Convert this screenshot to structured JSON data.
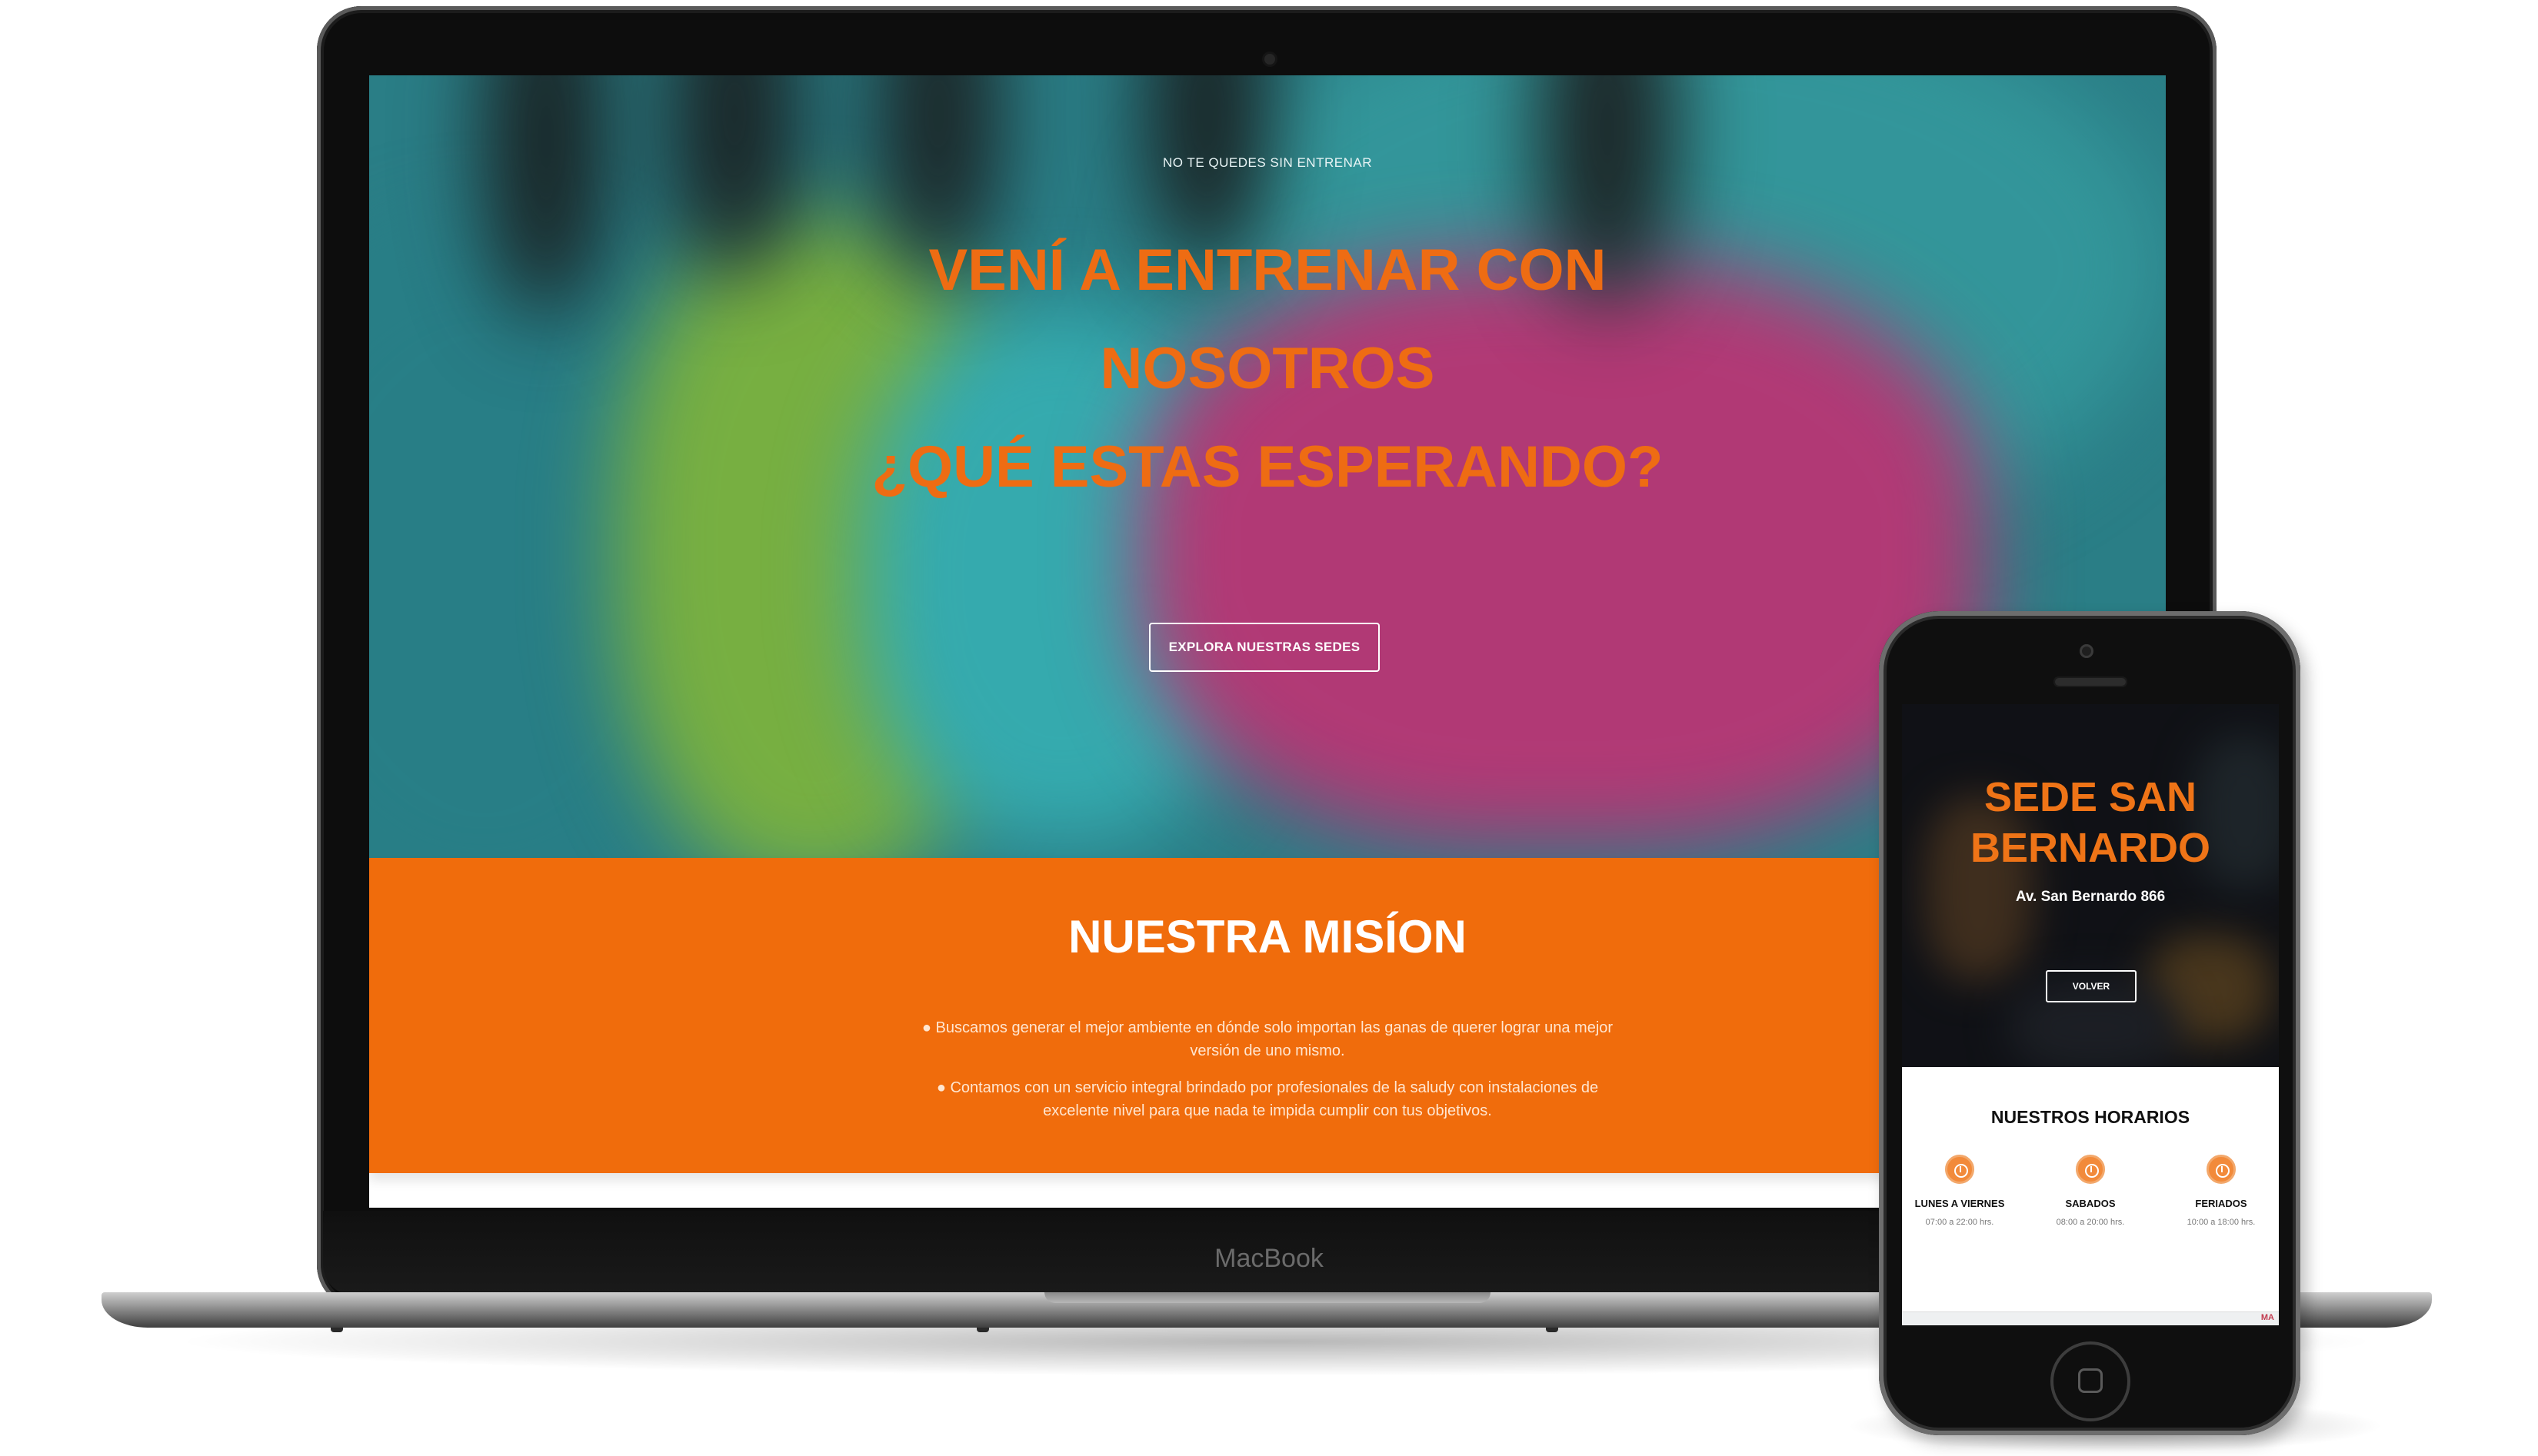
{
  "laptop": {
    "brand": "MacBook",
    "hero": {
      "kicker": "NO TE QUEDES SIN ENTRENAR",
      "title_lines": [
        "VENÍ A ENTRENAR CON",
        "NOSOTROS",
        "¿QUÉ ESTAS ESPERANDO?"
      ],
      "button_label": "EXPLORA NUESTRAS SEDES"
    },
    "mission": {
      "title": "NUESTRA MISÍON",
      "paragraphs": [
        "● Buscamos generar el mejor ambiente en dónde solo importan las ganas de querer lograr una mejor versión de uno mismo.",
        "● Contamos con un servicio integral brindado por profesionales de la saludy con instalaciones de excelente nivel para que nada te impida cumplir con tus objetivos."
      ]
    }
  },
  "phone": {
    "sede_title": "SEDE SAN BERNARDO",
    "address": "Av. San Bernardo 866",
    "button_label": "VOLVER",
    "horarios": {
      "title": "NUESTROS HORARIOS",
      "columns": [
        {
          "day": "LUNES A VIERNES",
          "hours": "07:00 a 22:00 hrs."
        },
        {
          "day": "SABADOS",
          "hours": "08:00 a 20:00 hrs."
        },
        {
          "day": "FERIADOS",
          "hours": "10:00 a 18:00 hrs."
        }
      ]
    },
    "map_label": "MA"
  },
  "colors": {
    "accent_orange": "#f06c0c",
    "hero_teal": "#2f8a93",
    "hero_pink": "#d4367e",
    "hero_green": "#8dc63f"
  },
  "icons": [
    "clock-icon"
  ]
}
